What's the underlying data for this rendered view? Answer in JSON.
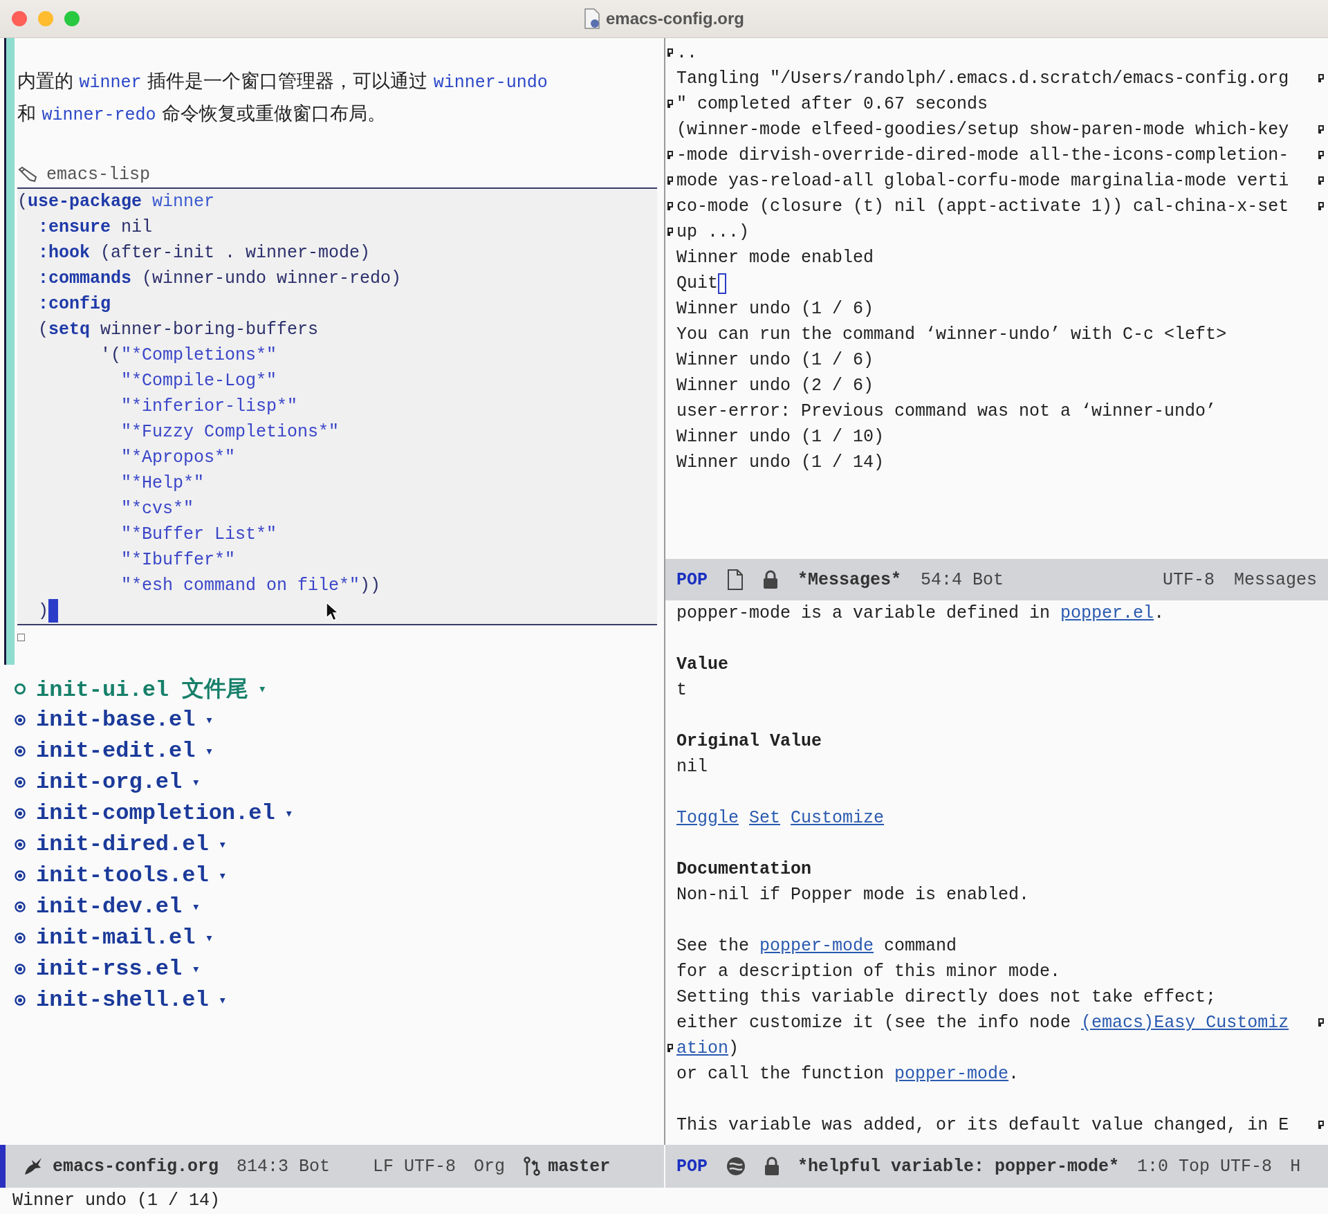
{
  "window": {
    "title": "emacs-config.org"
  },
  "org": {
    "paragraph": [
      [
        {
          "t": "内置的 ",
          "kind": "text"
        },
        {
          "t": "winner",
          "kind": "code"
        },
        {
          "t": " 插件是一个窗口管理器，可以通过 ",
          "kind": "text"
        },
        {
          "t": "winner-undo",
          "kind": "code"
        }
      ],
      [
        {
          "t": "和 ",
          "kind": "text"
        },
        {
          "t": "winner-redo",
          "kind": "code"
        },
        {
          "t": " 命令恢复或重做窗口布局。",
          "kind": "text"
        }
      ]
    ],
    "src_block": {
      "language": "emacs-lisp",
      "lines": [
        {
          "cursor": false,
          "segs": [
            {
              "t": "(",
              "kind": "plain"
            },
            {
              "t": "use-package",
              "kind": "kw"
            },
            {
              "t": " winner",
              "kind": "name"
            }
          ]
        },
        {
          "cursor": false,
          "segs": [
            {
              "t": "  :ensure",
              "kind": "kw"
            },
            {
              "t": " nil",
              "kind": "plain"
            }
          ]
        },
        {
          "cursor": false,
          "segs": [
            {
              "t": "  :hook",
              "kind": "kw"
            },
            {
              "t": " (after-init . winner-mode)",
              "kind": "plain"
            }
          ]
        },
        {
          "cursor": false,
          "segs": [
            {
              "t": "  :commands",
              "kind": "kw"
            },
            {
              "t": " (winner-undo winner-redo)",
              "kind": "plain"
            }
          ]
        },
        {
          "cursor": false,
          "segs": [
            {
              "t": "  :config",
              "kind": "kw"
            }
          ]
        },
        {
          "cursor": false,
          "segs": [
            {
              "t": "  (",
              "kind": "plain"
            },
            {
              "t": "setq",
              "kind": "kw"
            },
            {
              "t": " winner-boring-buffers",
              "kind": "plain"
            }
          ]
        },
        {
          "cursor": false,
          "segs": [
            {
              "t": "        '(",
              "kind": "plain"
            },
            {
              "t": "\"*Completions*\"",
              "kind": "str"
            }
          ]
        },
        {
          "cursor": false,
          "segs": [
            {
              "t": "          \"*Compile-Log*\"",
              "kind": "str"
            }
          ]
        },
        {
          "cursor": false,
          "segs": [
            {
              "t": "          \"*inferior-lisp*\"",
              "kind": "str"
            }
          ]
        },
        {
          "cursor": false,
          "segs": [
            {
              "t": "          \"*Fuzzy Completions*\"",
              "kind": "str"
            }
          ]
        },
        {
          "cursor": false,
          "segs": [
            {
              "t": "          \"*Apropos*\"",
              "kind": "str"
            }
          ]
        },
        {
          "cursor": false,
          "segs": [
            {
              "t": "          \"*Help*\"",
              "kind": "str"
            }
          ]
        },
        {
          "cursor": false,
          "segs": [
            {
              "t": "          \"*cvs*\"",
              "kind": "str"
            }
          ]
        },
        {
          "cursor": false,
          "segs": [
            {
              "t": "          \"*Buffer List*\"",
              "kind": "str"
            }
          ]
        },
        {
          "cursor": false,
          "segs": [
            {
              "t": "          \"*Ibuffer*\"",
              "kind": "str"
            }
          ]
        },
        {
          "cursor": false,
          "segs": [
            {
              "t": "          \"*esh command on file*\"",
              "kind": "str"
            },
            {
              "t": "))",
              "kind": "plain"
            }
          ]
        },
        {
          "cursor": true,
          "segs": [
            {
              "t": "  )",
              "kind": "plain"
            }
          ]
        }
      ]
    },
    "marker": "□"
  },
  "headings": [
    {
      "title": "init-ui.el 文件尾",
      "fold": "▾",
      "selected": true
    },
    {
      "title": "init-base.el",
      "fold": "▾",
      "selected": false
    },
    {
      "title": "init-edit.el",
      "fold": "▾",
      "selected": false
    },
    {
      "title": "init-org.el",
      "fold": "▾",
      "selected": false
    },
    {
      "title": "init-completion.el",
      "fold": "▾",
      "selected": false
    },
    {
      "title": "init-dired.el",
      "fold": "▾",
      "selected": false
    },
    {
      "title": "init-tools.el",
      "fold": "▾",
      "selected": false
    },
    {
      "title": "init-dev.el",
      "fold": "▾",
      "selected": false
    },
    {
      "title": "init-mail.el",
      "fold": "▾",
      "selected": false
    },
    {
      "title": "init-rss.el",
      "fold": "▾",
      "selected": false
    },
    {
      "title": "init-shell.el",
      "fold": "▾",
      "selected": false
    }
  ],
  "messages": {
    "lines": [
      {
        "text": "..",
        "wrap_in": true,
        "wrap_out": false,
        "cursor": false
      },
      {
        "text": "Tangling \"/Users/randolph/.emacs.d.scratch/emacs-config.org",
        "wrap_in": false,
        "wrap_out": true,
        "cursor": false
      },
      {
        "text": "\" completed after 0.67 seconds",
        "wrap_in": true,
        "wrap_out": false,
        "cursor": false
      },
      {
        "text": "(winner-mode elfeed-goodies/setup show-paren-mode which-key",
        "wrap_in": false,
        "wrap_out": true,
        "cursor": false
      },
      {
        "text": "-mode dirvish-override-dired-mode all-the-icons-completion-",
        "wrap_in": true,
        "wrap_out": true,
        "cursor": false
      },
      {
        "text": "mode yas-reload-all global-corfu-mode marginalia-mode verti",
        "wrap_in": true,
        "wrap_out": true,
        "cursor": false
      },
      {
        "text": "co-mode (closure (t) nil (appt-activate 1)) cal-china-x-set",
        "wrap_in": true,
        "wrap_out": true,
        "cursor": false
      },
      {
        "text": "up ...)",
        "wrap_in": true,
        "wrap_out": false,
        "cursor": false
      },
      {
        "text": "Winner mode enabled",
        "wrap_in": false,
        "wrap_out": false,
        "cursor": false
      },
      {
        "text": "Quit",
        "wrap_in": false,
        "wrap_out": false,
        "cursor": true
      },
      {
        "text": "Winner undo (1 / 6)",
        "wrap_in": false,
        "wrap_out": false,
        "cursor": false
      },
      {
        "text": "You can run the command ‘winner-undo’ with C-c <left>",
        "wrap_in": false,
        "wrap_out": false,
        "cursor": false
      },
      {
        "text": "Winner undo (1 / 6)",
        "wrap_in": false,
        "wrap_out": false,
        "cursor": false
      },
      {
        "text": "Winner undo (2 / 6)",
        "wrap_in": false,
        "wrap_out": false,
        "cursor": false
      },
      {
        "text": "user-error: Previous command was not a ‘winner-undo’",
        "wrap_in": false,
        "wrap_out": false,
        "cursor": false
      },
      {
        "text": "Winner undo (1 / 10)",
        "wrap_in": false,
        "wrap_out": false,
        "cursor": false
      },
      {
        "text": "Winner undo (1 / 14)",
        "wrap_in": false,
        "wrap_out": false,
        "cursor": false
      }
    ],
    "mode_line": {
      "tag": "POP",
      "buffer": "*Messages*",
      "position": "54:4 Bot",
      "encoding": "UTF-8",
      "mode": "Messages"
    }
  },
  "help": {
    "lines": [
      {
        "kind": "text",
        "wrap_in": false,
        "wrap_out": false,
        "segs": [
          {
            "t": "popper-mode is a variable defined in ",
            "kind": "text"
          },
          {
            "t": "popper.el",
            "kind": "link"
          },
          {
            "t": ".",
            "kind": "text"
          }
        ]
      },
      {
        "kind": "blank"
      },
      {
        "kind": "heading",
        "text": "Value"
      },
      {
        "kind": "text",
        "wrap_in": false,
        "wrap_out": false,
        "segs": [
          {
            "t": "t",
            "kind": "text"
          }
        ]
      },
      {
        "kind": "blank"
      },
      {
        "kind": "heading",
        "text": "Original Value"
      },
      {
        "kind": "text",
        "wrap_in": false,
        "wrap_out": false,
        "segs": [
          {
            "t": "nil",
            "kind": "text"
          }
        ]
      },
      {
        "kind": "blank"
      },
      {
        "kind": "buttons",
        "items": [
          "Toggle",
          "Set",
          "Customize"
        ]
      },
      {
        "kind": "blank"
      },
      {
        "kind": "heading",
        "text": "Documentation"
      },
      {
        "kind": "text",
        "wrap_in": false,
        "wrap_out": false,
        "segs": [
          {
            "t": "Non-nil if Popper mode is enabled.",
            "kind": "text"
          }
        ]
      },
      {
        "kind": "blank"
      },
      {
        "kind": "text",
        "wrap_in": false,
        "wrap_out": false,
        "segs": [
          {
            "t": "See the ",
            "kind": "text"
          },
          {
            "t": "popper-mode",
            "kind": "link"
          },
          {
            "t": " command",
            "kind": "text"
          }
        ]
      },
      {
        "kind": "text",
        "wrap_in": false,
        "wrap_out": false,
        "segs": [
          {
            "t": "for a description of this minor mode.",
            "kind": "text"
          }
        ]
      },
      {
        "kind": "text",
        "wrap_in": false,
        "wrap_out": false,
        "segs": [
          {
            "t": "Setting this variable directly does not take effect;",
            "kind": "text"
          }
        ]
      },
      {
        "kind": "text",
        "wrap_in": false,
        "wrap_out": true,
        "segs": [
          {
            "t": "either customize it (see the info node ",
            "kind": "text"
          },
          {
            "t": "(emacs)Easy Customiz",
            "kind": "link"
          }
        ]
      },
      {
        "kind": "text",
        "wrap_in": true,
        "wrap_out": false,
        "segs": [
          {
            "t": "ation",
            "kind": "link"
          },
          {
            "t": ")",
            "kind": "text"
          }
        ]
      },
      {
        "kind": "text",
        "wrap_in": false,
        "wrap_out": false,
        "segs": [
          {
            "t": "or call the function ",
            "kind": "text"
          },
          {
            "t": "popper-mode",
            "kind": "link"
          },
          {
            "t": ".",
            "kind": "text"
          }
        ]
      },
      {
        "kind": "blank"
      },
      {
        "kind": "text",
        "wrap_in": false,
        "wrap_out": true,
        "segs": [
          {
            "t": "This variable was added, or its default value changed, in E",
            "kind": "text"
          }
        ]
      }
    ]
  },
  "mode_line": {
    "active": true,
    "left": {
      "buffer": "emacs-config.org",
      "position": "814:3 Bot",
      "encoding": "LF UTF-8",
      "mode": "Org",
      "branch": "master"
    },
    "right": {
      "tag": "POP",
      "buffer": "*helpful variable: popper-mode*",
      "position": "1:0 Top UTF-8",
      "extra": "H"
    }
  },
  "echo_area": "Winner undo (1 / 14)"
}
